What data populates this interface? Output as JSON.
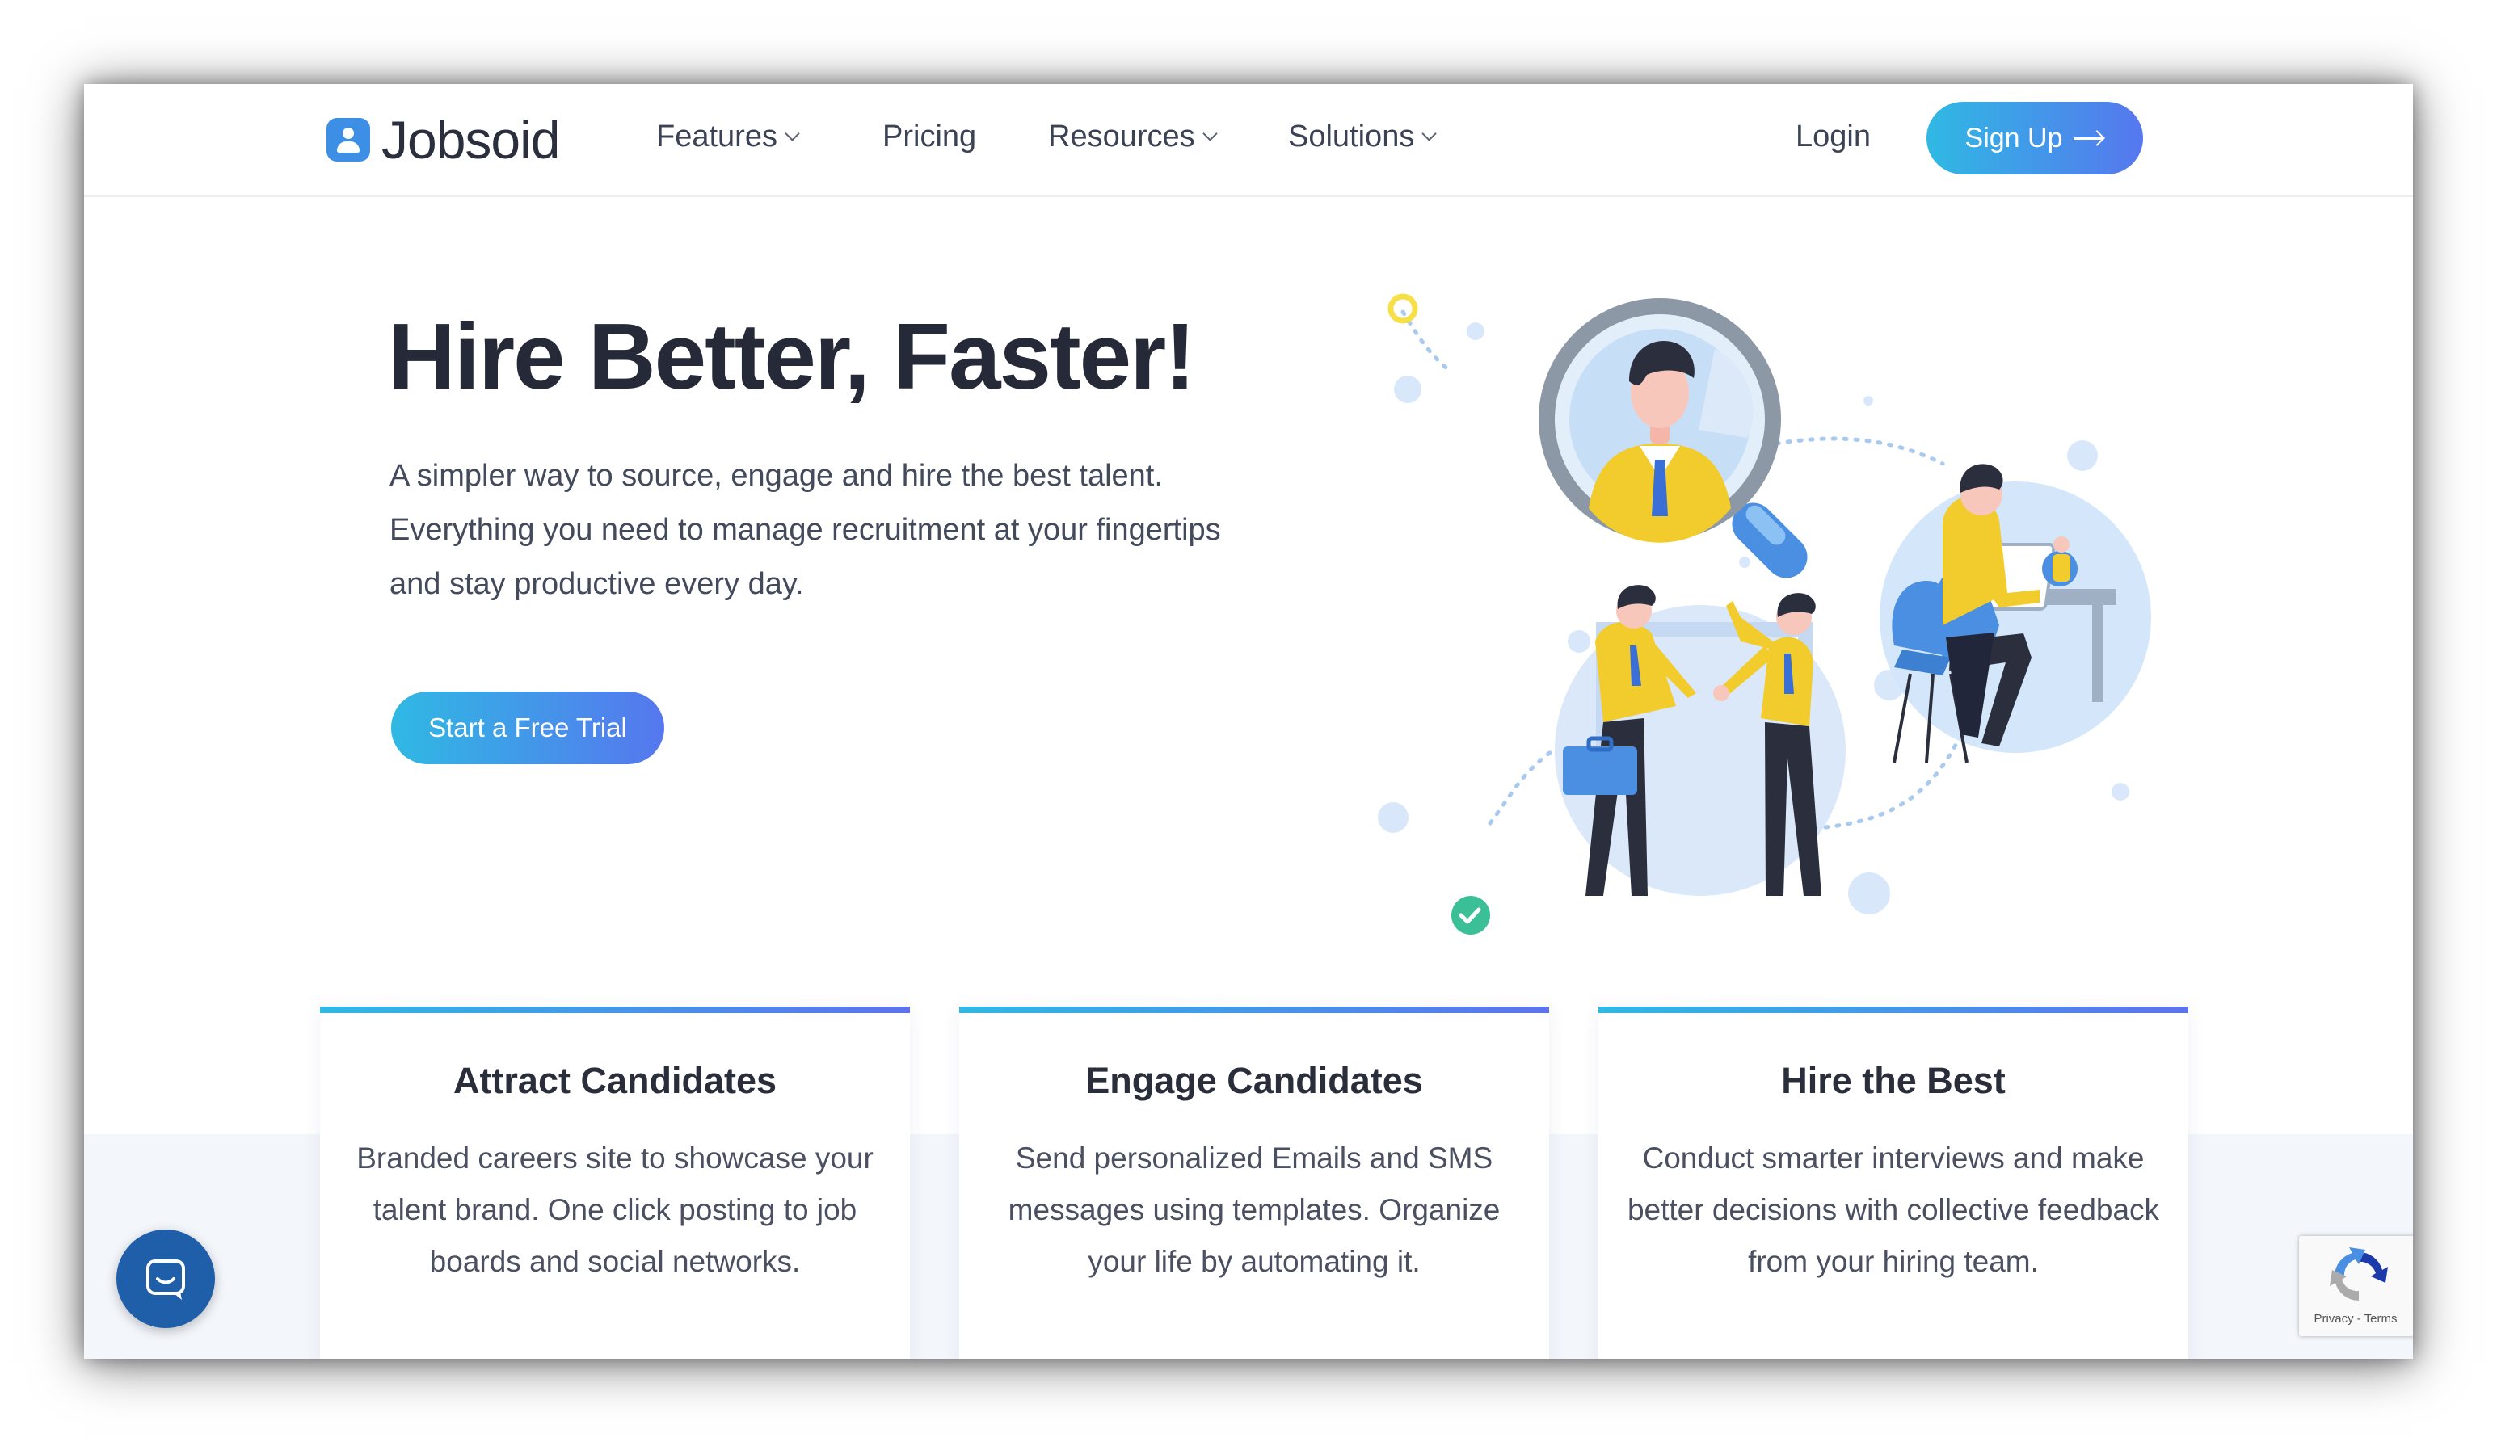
{
  "brand": {
    "name": "Jobsoid",
    "accent": "#3d8fe6",
    "gradient_start": "#2fb9e3",
    "gradient_end": "#5677ee"
  },
  "nav": {
    "items": [
      {
        "label": "Features",
        "dropdown": true
      },
      {
        "label": "Pricing",
        "dropdown": false
      },
      {
        "label": "Resources",
        "dropdown": true
      },
      {
        "label": "Solutions",
        "dropdown": true
      }
    ],
    "login": "Login",
    "signup": "Sign Up"
  },
  "hero": {
    "title": "Hire Better, Faster!",
    "subtitle": "A simpler way to source, engage and hire the best talent. Everything you need to manage recruitment at your fingertips and stay productive every day.",
    "cta": "Start a Free Trial"
  },
  "features": [
    {
      "title": "Attract Candidates",
      "text": "Branded careers site to showcase your talent brand. One click posting to job boards and social networks."
    },
    {
      "title": "Engage Candidates",
      "text": "Send personalized Emails and SMS messages using templates. Organize your life by automating it."
    },
    {
      "title": "Hire the Best",
      "text": "Conduct smarter interviews and make better decisions with collective feedback from your hiring team."
    }
  ],
  "recaptcha": {
    "links": "Privacy - Terms"
  },
  "icons": {
    "chat": "chat-bubble-icon",
    "recaptcha": "recaptcha-icon",
    "signup_arrow": "arrow-right-icon"
  }
}
